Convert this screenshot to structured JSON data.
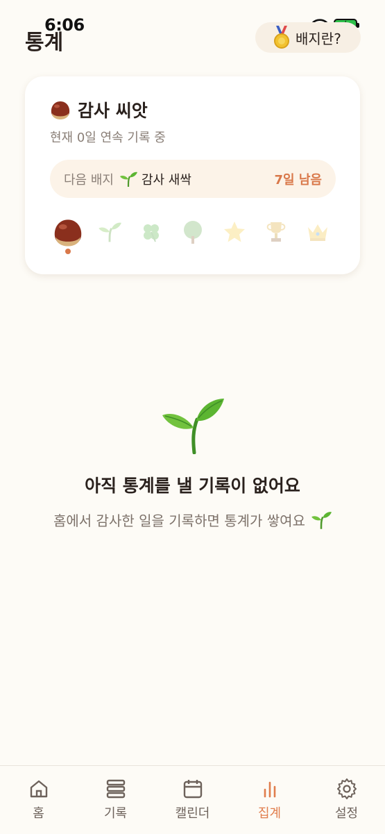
{
  "status_bar": {
    "time": "6:06"
  },
  "header": {
    "title": "통계",
    "badge_help_label": "배지란?"
  },
  "badge_card": {
    "current_badge": "감사 씨앗",
    "streak_text": "현재 0일 연속 기록 중",
    "next_label": "다음 배지",
    "next_badge": "감사 새싹",
    "remaining": "7일 남음",
    "stage_icons": [
      "chestnut-icon",
      "sprout-icon",
      "clover-icon",
      "tree-icon",
      "star-icon",
      "trophy-icon",
      "crown-icon"
    ],
    "current_stage_index": 0
  },
  "empty_state": {
    "title": "아직 통계를 낼 기록이 없어요",
    "description": "홈에서 감사한 일을 기록하면 통계가 쌓여요"
  },
  "tabbar": {
    "items": [
      {
        "label": "홈",
        "icon": "home-icon"
      },
      {
        "label": "기록",
        "icon": "list-icon"
      },
      {
        "label": "캘린더",
        "icon": "calendar-icon"
      },
      {
        "label": "집계",
        "icon": "chart-icon",
        "active": true
      },
      {
        "label": "설정",
        "icon": "gear-icon"
      }
    ]
  },
  "colors": {
    "accent": "#e07d4c",
    "background": "#fdfbf6",
    "card": "#ffffff"
  }
}
